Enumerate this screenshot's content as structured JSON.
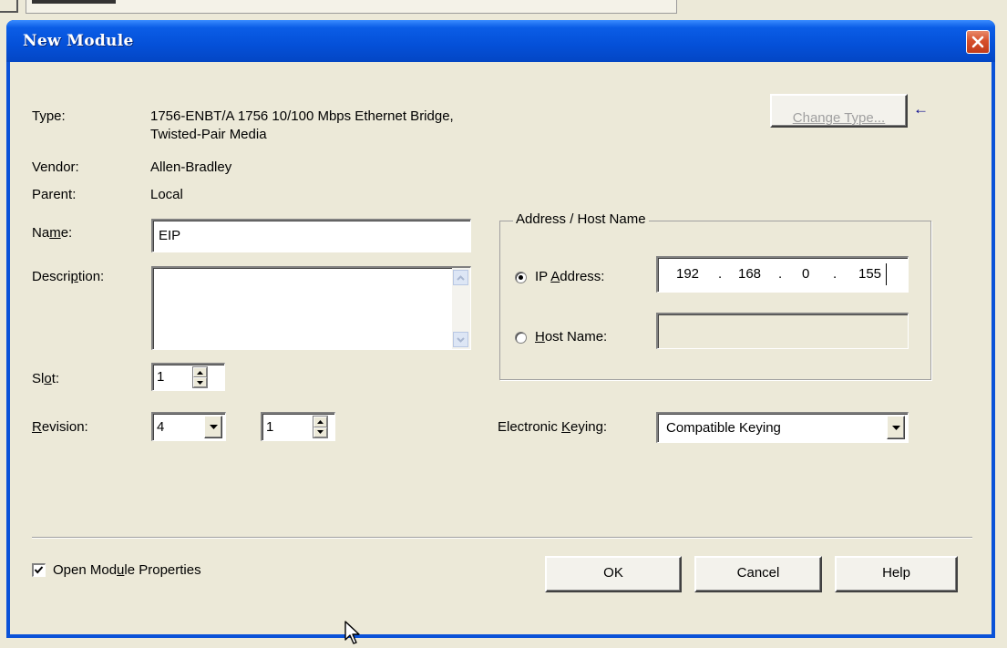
{
  "dialog": {
    "title": "New Module",
    "close_glyph": "✕"
  },
  "fields": {
    "type_label": "Type:",
    "type_value_line1": "1756-ENBT/A 1756 10/100 Mbps Ethernet Bridge,",
    "type_value_line2": "Twisted-Pair Media",
    "change_type_button": "Change Type...",
    "change_type_arrow": "←",
    "vendor_label": "Vendor:",
    "vendor_value": "Allen-Bradley",
    "parent_label": "Parent:",
    "parent_value": "Local",
    "name_label_pre": "Na",
    "name_label_ul": "m",
    "name_label_post": "e:",
    "name_value": "EIP",
    "description_label_pre": "Descri",
    "description_label_ul": "p",
    "description_label_post": "tion:",
    "description_value": "",
    "slot_label_pre": "Sl",
    "slot_label_ul": "o",
    "slot_label_post": "t:",
    "slot_value": "1",
    "revision_label_ul": "R",
    "revision_label_post": "evision:",
    "revision_major": "4",
    "revision_minor": "1"
  },
  "address": {
    "group_title": "Address / Host Name",
    "ip_label_pre": "IP ",
    "ip_label_ul": "A",
    "ip_label_post": "ddress:",
    "ip_octets": [
      "192",
      "168",
      "0",
      "155"
    ],
    "ip_dot": ".",
    "ip_selected": true,
    "host_label_ul": "H",
    "host_label_post": "ost Name:",
    "host_value": ""
  },
  "keying": {
    "label_pre": "Electronic ",
    "label_ul": "K",
    "label_post": "eying:",
    "value": "Compatible Keying"
  },
  "footer": {
    "open_props_pre": "Open Mod",
    "open_props_ul": "u",
    "open_props_post": "le Properties",
    "open_props_checked": true,
    "ok_label": "OK",
    "cancel_label": "Cancel",
    "help_label": "Help"
  },
  "colors": {
    "titlebar": "#0450d8",
    "dialog_bg": "#ece9d8",
    "close_button": "#d6502c",
    "disabled_text": "#a0a0a0"
  }
}
